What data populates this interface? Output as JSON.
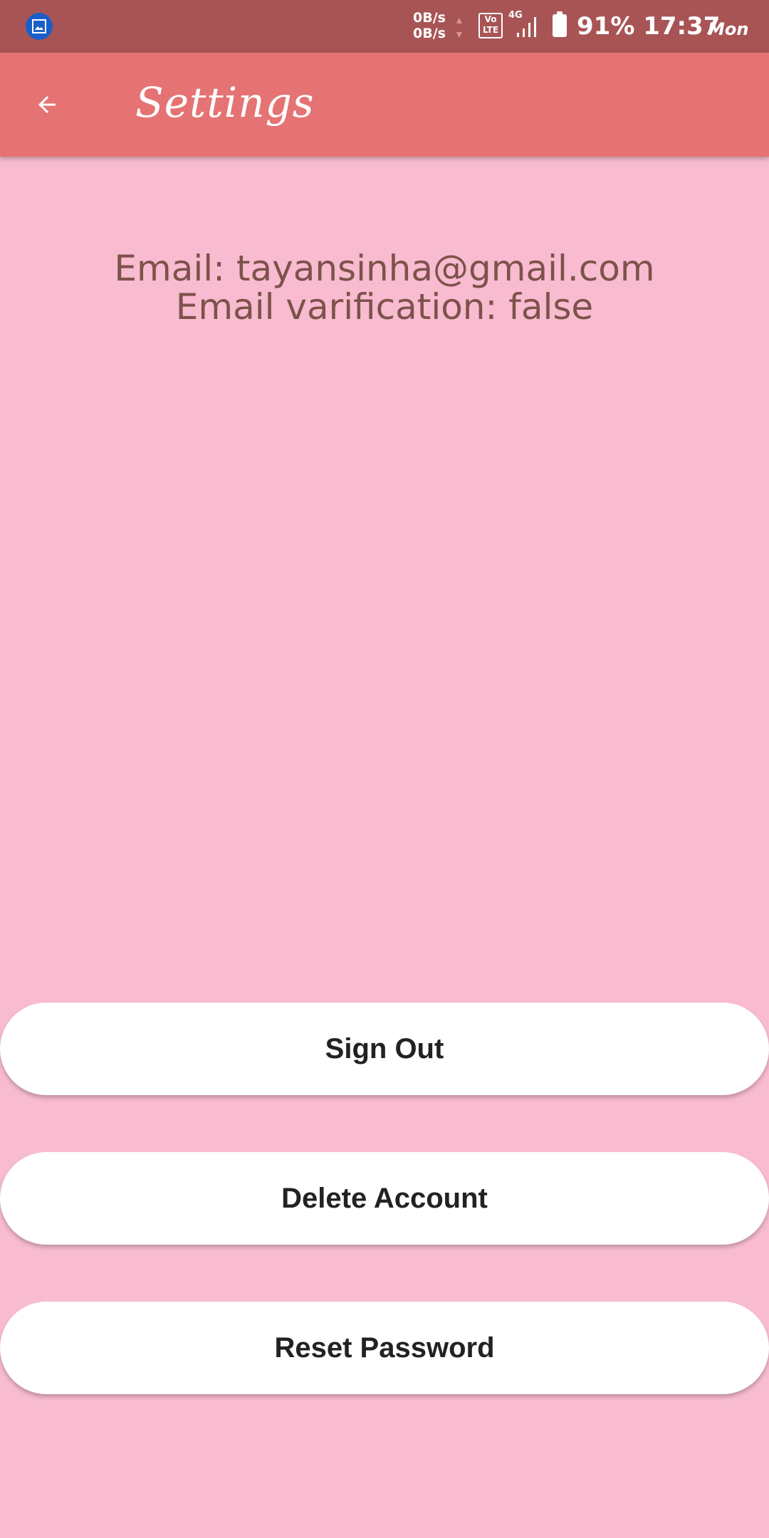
{
  "status_bar": {
    "net_speed_up": "0B/s",
    "net_speed_down": "0B/s",
    "volte_label_top": "Vo",
    "volte_label_bottom": "LTE",
    "network_type": "4G",
    "battery": "91%",
    "time": "17:37",
    "day": "Mon"
  },
  "app_bar": {
    "title": "Settings",
    "back_icon": "arrow-back-icon"
  },
  "info": {
    "email_line": "Email: tayansinha@gmail.com",
    "verification_line": "Email varification: false"
  },
  "buttons": {
    "sign_out": "Sign Out",
    "delete_account": "Delete Account",
    "reset_password": "Reset Password"
  },
  "colors": {
    "status_bar": "#a85455",
    "app_bar": "#e57373",
    "background": "#f8bbd0",
    "info_text": "#7d524a",
    "button_bg": "#ffffff",
    "button_text": "#222222"
  }
}
